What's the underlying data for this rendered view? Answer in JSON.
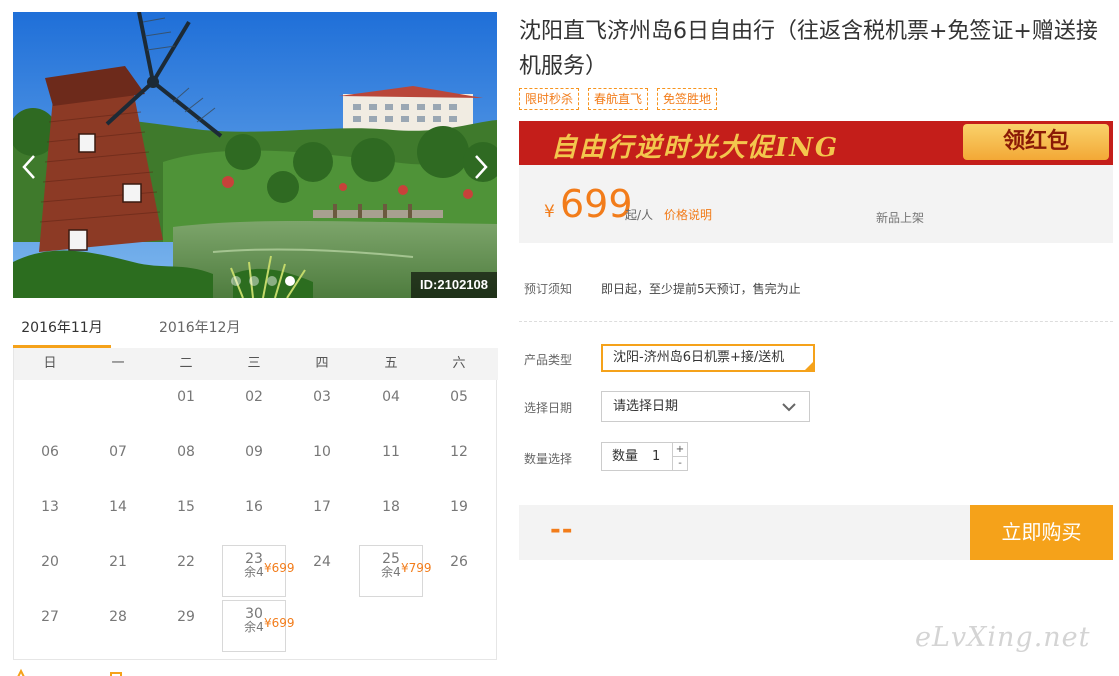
{
  "gallery": {
    "image_id": "ID:2102108",
    "dots": 4,
    "active_dot": 3
  },
  "calendar": {
    "tabs": [
      "2016年11月",
      "2016年12月"
    ],
    "active_tab": 0,
    "weekdays": [
      "日",
      "一",
      "二",
      "三",
      "四",
      "五",
      "六"
    ],
    "first_weekday": 2,
    "days_in_month": 30,
    "available": {
      "23": {
        "price": "¥699",
        "remain": "余4"
      },
      "25": {
        "price": "¥799",
        "remain": "余4"
      },
      "30": {
        "price": "¥699",
        "remain": "余4"
      }
    }
  },
  "product": {
    "title": "沈阳直飞济州岛6日自由行（往返含税机票+免签证+赠送接机服务）",
    "tags": [
      "限时秒杀",
      "春航直飞",
      "免签胜地"
    ],
    "banner_text": "自由行逆时光大促ING",
    "banner_button": "领红包",
    "currency": "¥",
    "price": "699",
    "price_unit": "起/人",
    "price_note": "价格说明",
    "new_label": "新品上架"
  },
  "booking": {
    "notice_label": "预订须知",
    "notice_value": "即日起，至少提前5天预订，售完为止",
    "type_label": "产品类型",
    "type_value": "沈阳-济州岛6日机票+接/送机",
    "date_label": "选择日期",
    "date_placeholder": "请选择日期",
    "qty_label": "数量选择",
    "qty_prefix": "数量",
    "qty_value": "1",
    "qty_plus": "+",
    "qty_minus": "-",
    "total": "--",
    "buy_button": "立即购买"
  },
  "watermark": "eLvXing.net",
  "colors": {
    "accent": "#f5a21a",
    "price": "#f27c1a",
    "banner": "#c41e1a"
  }
}
